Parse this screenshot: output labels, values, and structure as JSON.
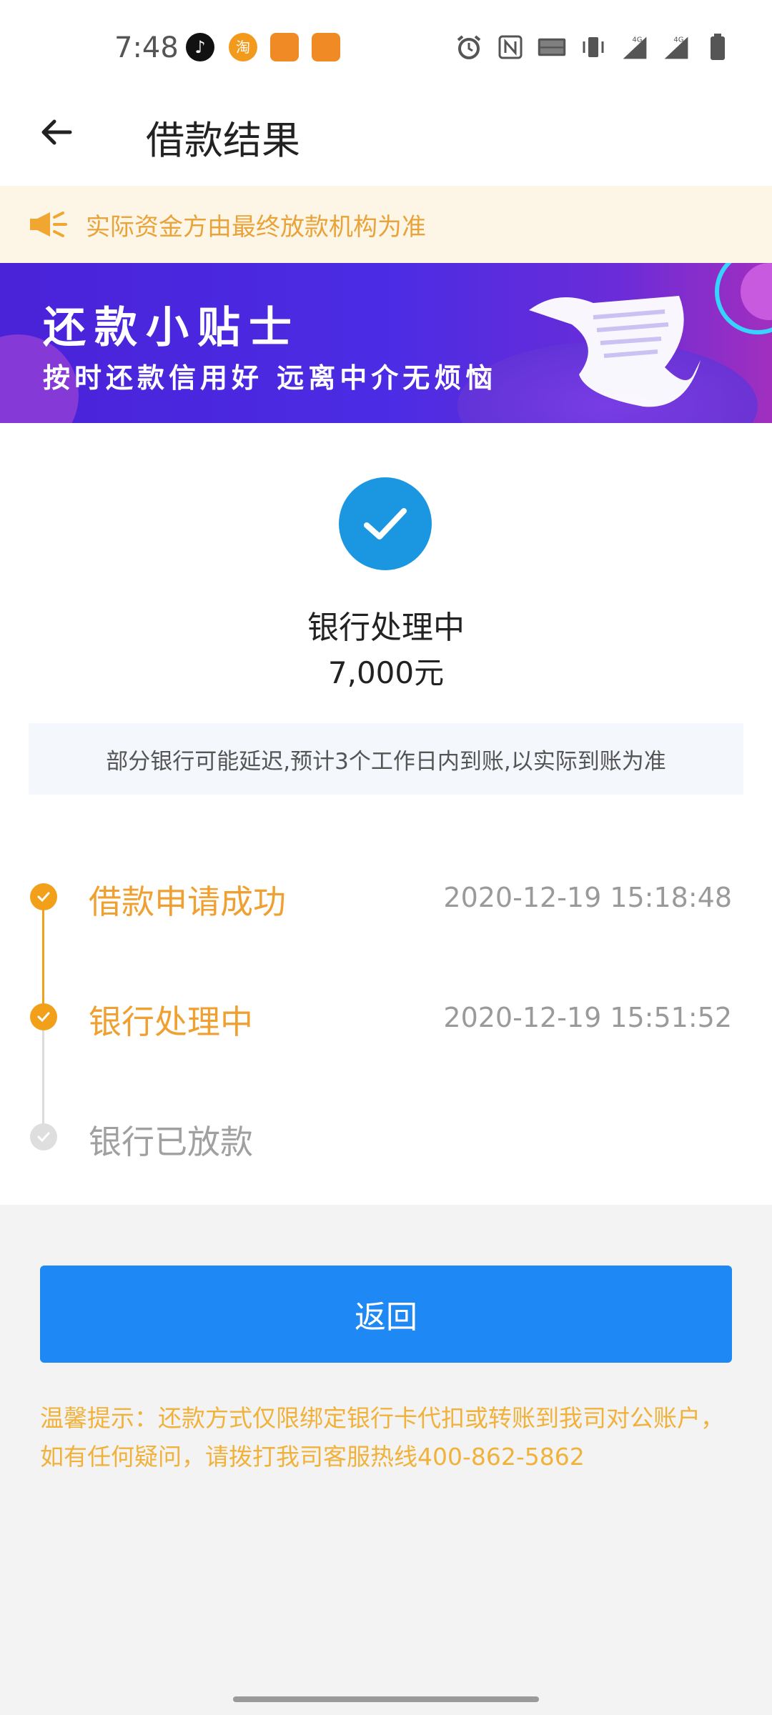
{
  "status_bar": {
    "time": "7:48",
    "apps": [
      {
        "name": "tiktok-icon",
        "glyph": "♪"
      },
      {
        "name": "taobao-icon",
        "glyph": "淘"
      },
      {
        "name": "bird-app-icon"
      },
      {
        "name": "bird-app-icon"
      }
    ],
    "right_icons": [
      "alarm-icon",
      "nfc-icon",
      "volte-icon",
      "vibrate-icon",
      "signal-4g-icon",
      "signal-4g-icon",
      "battery-icon"
    ]
  },
  "header": {
    "title": "借款结果"
  },
  "notice": {
    "text": "实际资金方由最终放款机构为准",
    "color": "#e8a33a"
  },
  "banner": {
    "title": "还款小贴士",
    "subtitle": "按时还款信用好 远离中介无烦恼"
  },
  "result": {
    "status": "银行处理中",
    "amount": "7,000元",
    "info": "部分银行可能延迟,预计3个工作日内到账,以实际到账为准"
  },
  "timeline": [
    {
      "label": "借款申请成功",
      "time": "2020-12-19 15:18:48",
      "state": "done"
    },
    {
      "label": "银行处理中",
      "time": "2020-12-19 15:51:52",
      "state": "done"
    },
    {
      "label": "银行已放款",
      "time": "",
      "state": "pending"
    }
  ],
  "footer": {
    "return_label": "返回",
    "tip": "温馨提示：还款方式仅限绑定银行卡代扣或转账到我司对公账户，如有任何疑问，请拨打我司客服热线400-862-5862"
  },
  "colors": {
    "accent_blue": "#1e88f5",
    "check_blue": "#1a97e0",
    "timeline_orange": "#f2a019",
    "tip_orange": "#f1b23c"
  }
}
